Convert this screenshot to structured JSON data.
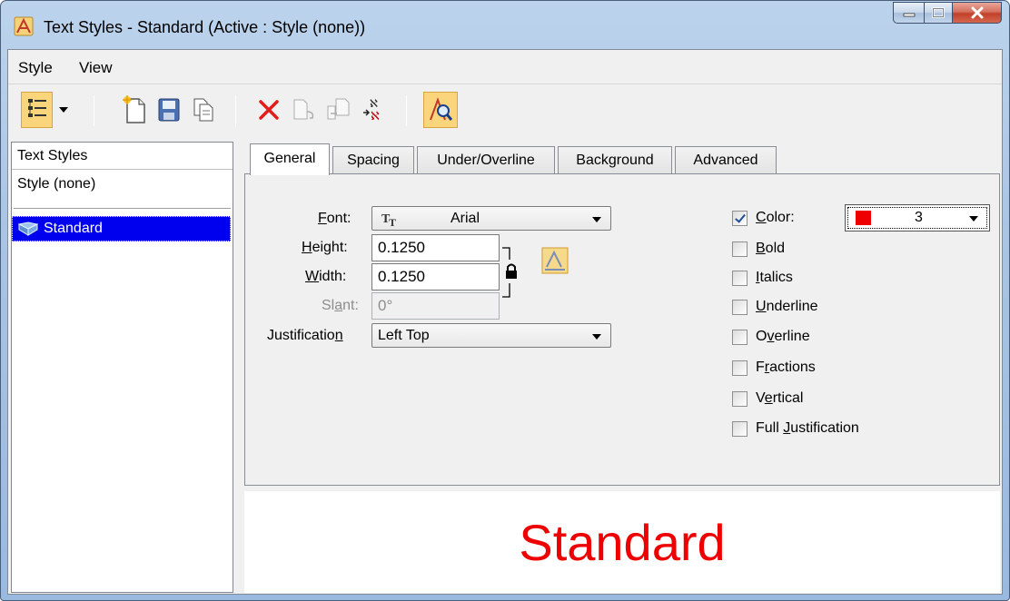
{
  "window": {
    "title": "Text Styles - Standard (Active : Style (none))",
    "icon": "text-styles-app-icon"
  },
  "menu": [
    "Style",
    "View"
  ],
  "toolbar": {
    "buttons": [
      "list-view-icon",
      "dropdown-arrow-icon",
      "new-style-icon",
      "save-style-icon",
      "copy-style-icon",
      "delete-style-icon",
      "reset-style-icon",
      "update-style-icon",
      "import-style-icon",
      "preview-zoom-icon"
    ]
  },
  "left_panel": {
    "header": "Text Styles",
    "none_item": "Style (none)",
    "items": [
      {
        "label": "Standard",
        "selected": true
      }
    ]
  },
  "tabs": [
    "General",
    "Spacing",
    "Under/Overline",
    "Background",
    "Advanced"
  ],
  "active_tab": "General",
  "general": {
    "font": {
      "label_u": "F",
      "label_rest": "ont:",
      "value": "Arial"
    },
    "height": {
      "label_u": "H",
      "label_rest": "eight:",
      "value": "0.1250"
    },
    "width": {
      "label_u": "W",
      "label_rest": "idth:",
      "value": "0.1250"
    },
    "slant": {
      "label_pre": "Sl",
      "label_u": "a",
      "label_rest": "nt:",
      "value": "0°"
    },
    "justification": {
      "label_pre": "Justificatio",
      "label_u": "n",
      "value": "Left Top"
    },
    "color": {
      "label_u": "C",
      "label_rest": "olor:",
      "checked": true,
      "value": "3",
      "swatch": "#ee0000"
    },
    "checkboxes": [
      {
        "pre": "",
        "u": "B",
        "rest": "old",
        "checked": false
      },
      {
        "pre": "",
        "u": "I",
        "rest": "talics",
        "checked": false
      },
      {
        "pre": "",
        "u": "U",
        "rest": "nderline",
        "checked": false
      },
      {
        "pre": "O",
        "u": "v",
        "rest": "erline",
        "checked": false
      },
      {
        "pre": "F",
        "u": "r",
        "rest": "actions",
        "checked": false
      },
      {
        "pre": "V",
        "u": "e",
        "rest": "rtical",
        "checked": false
      },
      {
        "pre": "Full ",
        "u": "J",
        "rest": "ustification",
        "checked": false
      }
    ]
  },
  "preview": {
    "text": "Standard",
    "color": "#ee0000"
  }
}
